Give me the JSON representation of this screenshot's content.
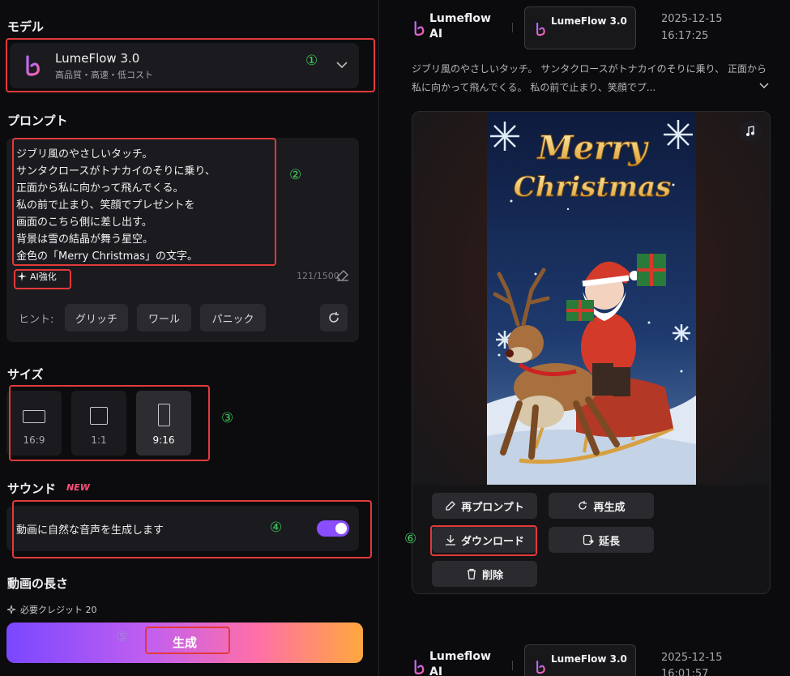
{
  "left": {
    "model_section": "モデル",
    "model": {
      "name": "LumeFlow 3.0",
      "subtitle": "高品質・高速・低コスト"
    },
    "prompt_section": "プロンプト",
    "prompt_text": "ジブリ風のやさしいタッチ。\nサンタクロースがトナカイのそりに乗り、\n正面から私に向かって飛んでくる。\n私の前で止まり、笑顔でプレゼントを\n画面のこちら側に差し出す。\n背景は雪の結晶が舞う星空。\n金色の「Merry Christmas」の文字。",
    "ai_enhance": "AI強化",
    "char_count": "121/1500",
    "hint_label": "ヒント:",
    "hints": [
      "グリッチ",
      "ワール",
      "パニック"
    ],
    "size_section": "サイズ",
    "sizes": [
      "16:9",
      "1:1",
      "9:16"
    ],
    "selected_size": "9:16",
    "sound_section": "サウンド",
    "new_badge": "NEW",
    "sound_toggle_label": "動画に自然な音声を生成します",
    "sound_enabled": true,
    "length_section": "動画の長さ",
    "credit_text": "必要クレジット 20",
    "generate_label": "生成"
  },
  "annotations": [
    "①",
    "②",
    "③",
    "④",
    "⑤",
    "⑥"
  ],
  "right": {
    "entries": [
      {
        "app_name": "Lumeflow AI",
        "model_chip": "LumeFlow 3.0",
        "date": "2025-12-15",
        "time": "16:17:25"
      },
      {
        "app_name": "Lumeflow AI",
        "model_chip": "LumeFlow 3.0",
        "date": "2025-12-15",
        "time": "16:01:57"
      }
    ],
    "description": "ジブリ風のやさしいタッチ。 サンタクロースがトナカイのそりに乗り、 正面から私に向かって飛んでくる。 私の前で止まり、笑顔でプ...",
    "media_title_1": "Merry",
    "media_title_2": "Christmas",
    "actions": {
      "reprompt": "再プロンプト",
      "regenerate": "再生成",
      "download": "ダウンロード",
      "extend": "延長",
      "delete": "削除"
    }
  },
  "colors": {
    "accent": "#8a4dff",
    "annotation_red": "#e23a3a",
    "annotation_green": "#3ecb5a"
  }
}
